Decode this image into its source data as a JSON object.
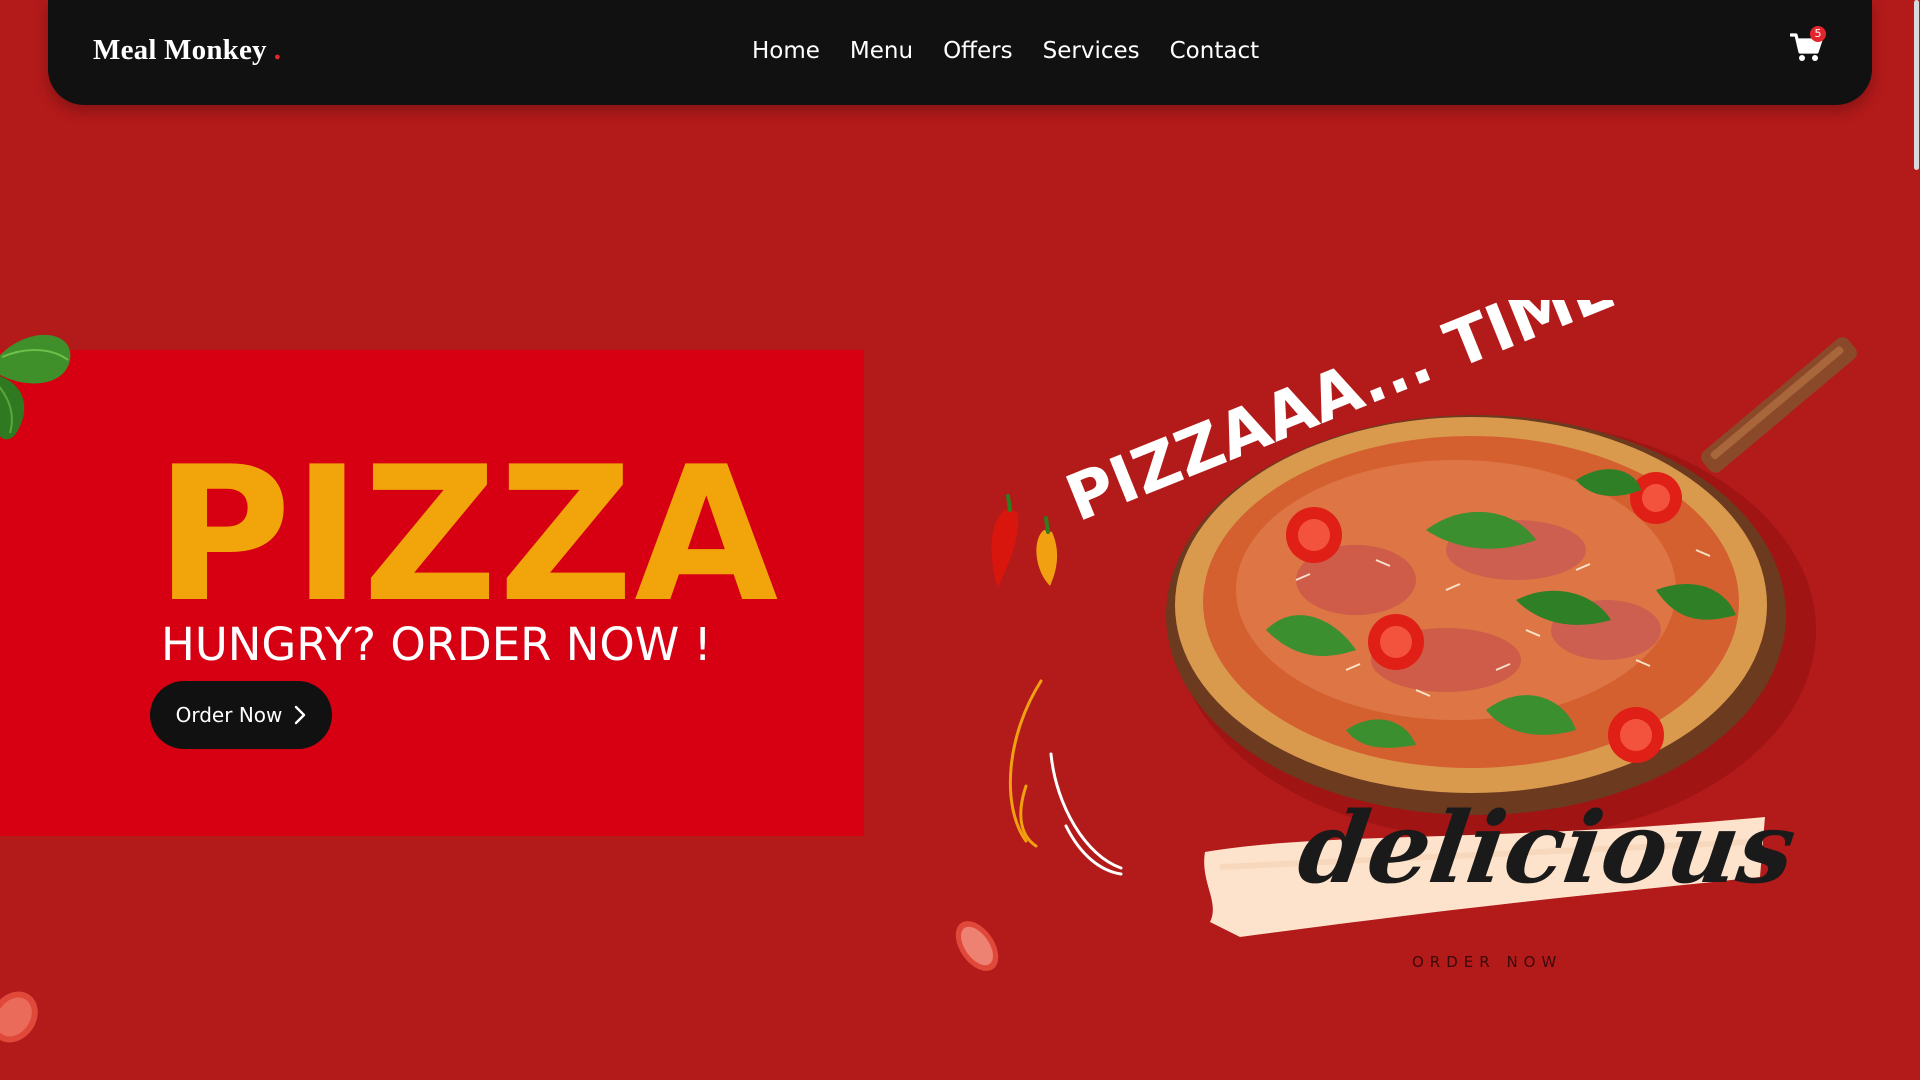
{
  "brand": {
    "name": "Meal Monkey",
    "dot": "."
  },
  "nav": {
    "items": [
      {
        "label": "Home"
      },
      {
        "label": "Menu"
      },
      {
        "label": "Offers"
      },
      {
        "label": "Services"
      },
      {
        "label": "Contact"
      }
    ]
  },
  "cart": {
    "icon": "shopping-cart-icon",
    "count": "5"
  },
  "hero": {
    "title": "PIZZA",
    "subtitle": "HUNGRY? ORDER NOW !",
    "button_label": "Order Now",
    "button_icon": "chevron-right-icon"
  },
  "promo": {
    "headline": "PIZZAAA... TIME",
    "tagline": "delicious",
    "cta": "ORDER NOW"
  },
  "colors": {
    "page_background": "#b31a1a",
    "hero_box": "#d60012",
    "title_yellow": "#f2a50a",
    "navbar": "#111111",
    "accent_red": "#e3262e"
  }
}
